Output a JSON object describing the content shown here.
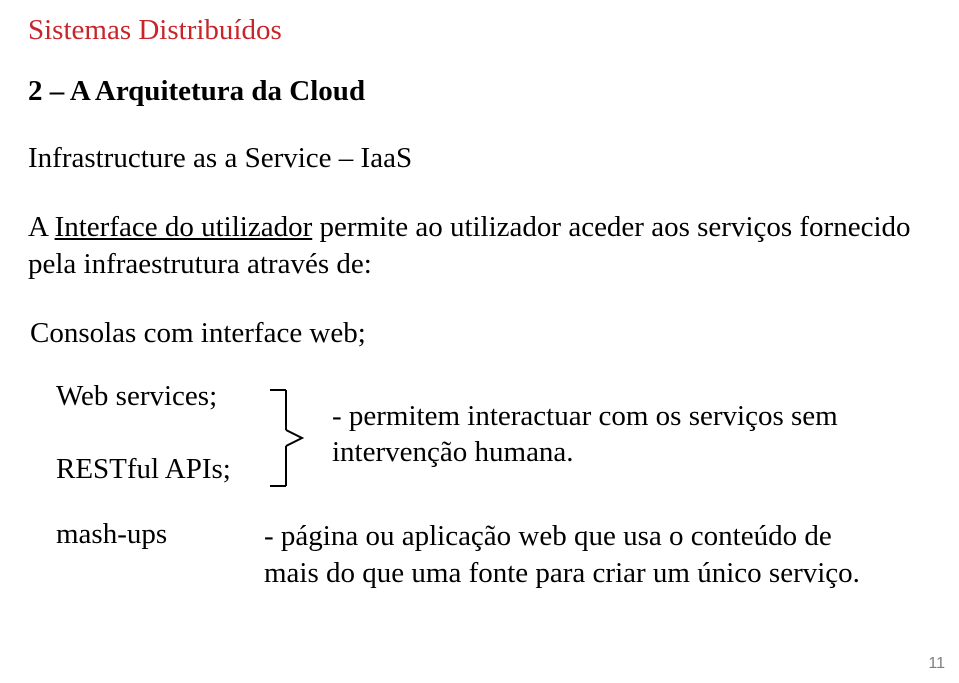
{
  "header": "Sistemas Distribuídos",
  "title": "2 – A Arquitetura da Cloud",
  "subtitle": "Infrastructure as a Service – IaaS",
  "intro_prefix": "A ",
  "intro_underlined": "Interface do utilizador",
  "intro_rest": " permite ao utilizador aceder aos serviços fornecido pela infraestrutura através de:",
  "bullet_consolas": "Consolas com interface web;",
  "left_web": "Web services;",
  "left_rest": "RESTful APIs;",
  "brace_desc_line1": "- permitem interactuar com os serviços sem",
  "brace_desc_line2": "  intervenção humana.",
  "mash_label": "mash-ups",
  "mash_desc_line1": "- página ou aplicação web que usa o conteúdo de",
  "mash_desc_line2": "  mais do que uma fonte para criar um único serviço.",
  "page_number": "11"
}
